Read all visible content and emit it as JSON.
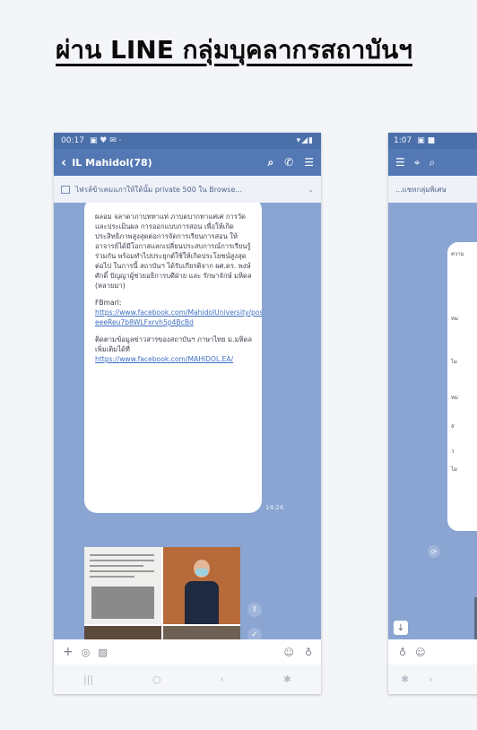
{
  "slide": {
    "title": "ผ่าน LINE กลุ่มบุคลากรสถาบันฯ"
  },
  "phone1": {
    "status_time": "00:17",
    "status_icons": "▾◢▮",
    "chat_title": "IL Mahidol(78)",
    "notice_text": "ไฟรล์ข้าเคมแภาให้ใต้นั้ม private 500 ใน Browse...",
    "bubble_paragraph1": "ผลอม จลาดาภาบททาแท่ ภาบดบากทาแศเศ การวัดและประเมินผล การออกแบบการสอน เพื่อให้เกิดประสิทธิภาพสูงสุดต่อการจัดการเรียนการสอน ให้อาจารย์ได้มีโอกาสแลกเปลี่ยนประสบการณ์การเรียนรู้ร่วมกัน พร้อมทำไปประยุกต์ใช้ให้เกิดประโยชน์สูงสุดต่อไป ในการนี้ สถาบันฯ ได้รับเกียรติจาก ผศ.ดร. พงษ์ศักดิ์ ปัญญาผู้ช่วยอธิการบดีฝ่าย และ รักษาจักษ์ มหิดล (หลายมา)",
    "facebook_label": "FBmarl:",
    "facebook_link": "https://www.facebook.com/MahidolUniversity/posts/pfbid02mhJ5X7eT5wcqqPhUF8A1XgkmtssmLh7mmhg3?eeeReu7b8WLFxrvh5p4BcBd",
    "follow_text": "ติดตามข้อมูลข่าวสารของสถาบันฯ ภาษาไทย ม.มหิดล เพิ่มเติมได้ที่",
    "follow_link": "https://www.facebook.com/MAHIDOL.EA/",
    "time_label": "14:24",
    "share_icon": "share-icon",
    "check_icon": "check-icon"
  },
  "phone2": {
    "status_time": "1:07",
    "notice_text": "...แชทกลุ่มพิเศษ",
    "bubble_lines": [
      "ความ",
      "ทม",
      "ไม",
      "ทม",
      "ส",
      "ว",
      "ไม"
    ]
  }
}
